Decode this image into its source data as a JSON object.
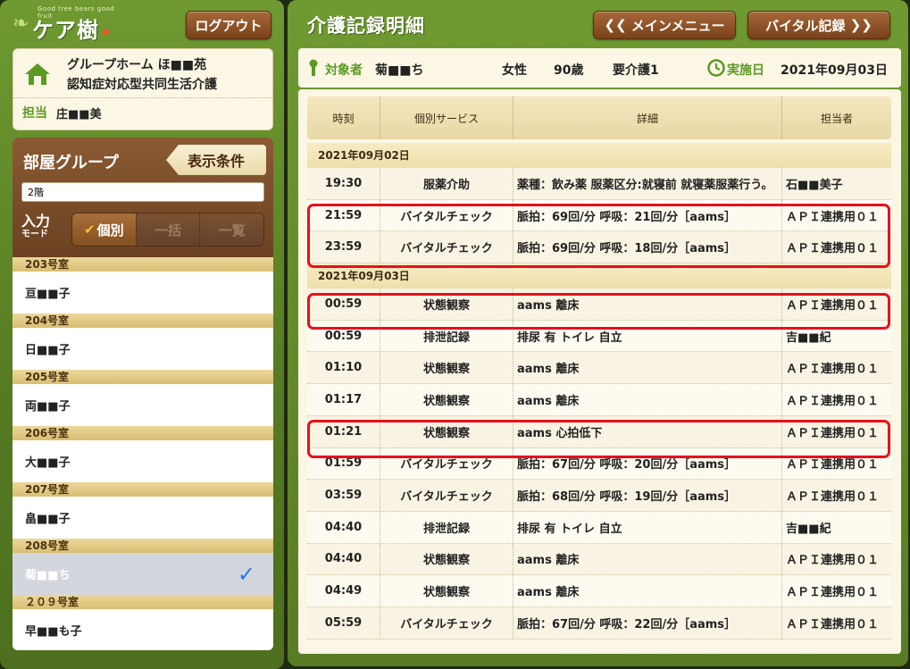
{
  "app": {
    "logo_text": "ケア樹",
    "logo_tagline": "Good tree bears good fruit",
    "logout_label": "ログアウト"
  },
  "facility": {
    "line1": "グループホーム ほ■■苑",
    "line2": "認知症対応型共同生活介護",
    "staff_label": "担当",
    "staff_name": "庄■■美"
  },
  "room_panel": {
    "title": "部屋グループ",
    "display_conditions_label": "表示条件",
    "floor_value": "2階",
    "mode_label_top": "入力",
    "mode_label_bottom": "モード",
    "modes": [
      "個別",
      "一括",
      "一覧"
    ],
    "active_mode": "個別",
    "rooms": [
      {
        "room": "203号室",
        "resident": "亘■■子",
        "selected": false
      },
      {
        "room": "204号室",
        "resident": "日■■子",
        "selected": false
      },
      {
        "room": "205号室",
        "resident": "両■■子",
        "selected": false
      },
      {
        "room": "206号室",
        "resident": "大■■子",
        "selected": false
      },
      {
        "room": "207号室",
        "resident": "畠■■子",
        "selected": false
      },
      {
        "room": "208号室",
        "resident": "菊■■ち",
        "selected": true
      },
      {
        "room": "２０９号室",
        "resident": "早■■も子",
        "selected": false
      }
    ]
  },
  "header": {
    "title": "介護記録明細",
    "main_menu_label": "メインメニュー",
    "vital_record_label": "バイタル記録"
  },
  "subject": {
    "label": "対象者",
    "name": "菊■■ち",
    "sex": "女性",
    "age": "90歳",
    "care_level": "要介護1",
    "date_label": "実施日",
    "date": "2021年09月03日"
  },
  "table": {
    "columns": [
      "時刻",
      "個別サービス",
      "詳細",
      "担当者"
    ],
    "groups": [
      {
        "date": "2021年09月02日",
        "rows": [
          {
            "time": "19:30",
            "service": "服薬介助",
            "detail": "薬種：飲み薬 服薬区分:就寝前 就寝薬服薬行う。",
            "staff": "石■■美子"
          },
          {
            "time": "21:59",
            "service": "バイタルチェック",
            "detail": "脈拍：69回/分 呼吸：21回/分［aams］",
            "staff": "ＡＰＩ連携用０１"
          },
          {
            "time": "23:59",
            "service": "バイタルチェック",
            "detail": "脈拍：69回/分 呼吸：18回/分［aams］",
            "staff": "ＡＰＩ連携用０１"
          }
        ]
      },
      {
        "date": "2021年09月03日",
        "rows": [
          {
            "time": "00:59",
            "service": "状態観察",
            "detail": "aams 離床",
            "staff": "ＡＰＩ連携用０１"
          },
          {
            "time": "00:59",
            "service": "排泄記録",
            "detail": "排尿 有 トイレ 自立",
            "staff": "吉■■紀"
          },
          {
            "time": "01:10",
            "service": "状態観察",
            "detail": "aams 離床",
            "staff": "ＡＰＩ連携用０１"
          },
          {
            "time": "01:17",
            "service": "状態観察",
            "detail": "aams 離床",
            "staff": "ＡＰＩ連携用０１"
          },
          {
            "time": "01:21",
            "service": "状態観察",
            "detail": "aams 心拍低下",
            "staff": "ＡＰＩ連携用０１"
          },
          {
            "time": "01:59",
            "service": "バイタルチェック",
            "detail": "脈拍：67回/分 呼吸：20回/分［aams］",
            "staff": "ＡＰＩ連携用０１"
          },
          {
            "time": "03:59",
            "service": "バイタルチェック",
            "detail": "脈拍：68回/分 呼吸：19回/分［aams］",
            "staff": "ＡＰＩ連携用０１"
          },
          {
            "time": "04:40",
            "service": "排泄記録",
            "detail": "排尿 有 トイレ 自立",
            "staff": "吉■■紀"
          },
          {
            "time": "04:40",
            "service": "状態観察",
            "detail": "aams 離床",
            "staff": "ＡＰＩ連携用０１"
          },
          {
            "time": "04:49",
            "service": "状態観察",
            "detail": "aams 離床",
            "staff": "ＡＰＩ連携用０１"
          },
          {
            "time": "05:59",
            "service": "バイタルチェック",
            "detail": "脈拍：67回/分 呼吸：22回/分［aams］",
            "staff": "ＡＰＩ連携用０１"
          }
        ]
      }
    ]
  },
  "colors": {
    "frame_green": "#6f9a31",
    "accent_green": "#5c9a24",
    "button_brown": "#8a5227",
    "highlight_red": "#e8101b",
    "selected_check": "#1e7cf2"
  },
  "icons": [
    "home-icon",
    "person-icon",
    "clock-icon",
    "checkmark-icon",
    "chevron-left-icon",
    "chevron-right-icon"
  ]
}
